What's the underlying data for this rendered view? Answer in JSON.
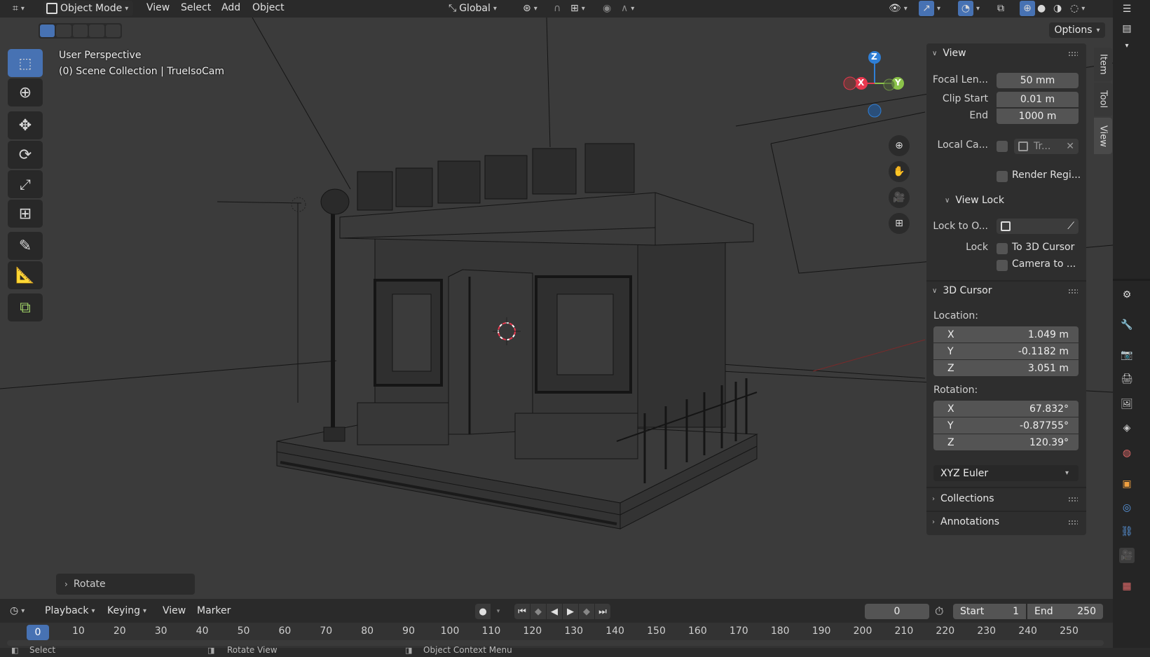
{
  "header": {
    "mode": "Object Mode",
    "menus": [
      "View",
      "Select",
      "Add",
      "Object"
    ],
    "orientation": "Global",
    "options_label": "Options"
  },
  "viewport": {
    "overlay_line1": "User Perspective",
    "overlay_line2": "(0) Scene Collection | TrueIsoCam",
    "gizmo_x": "X",
    "gizmo_y": "Y",
    "gizmo_z": "Z",
    "last_operator": "Rotate"
  },
  "tools": [
    "select-box",
    "cursor",
    "move",
    "rotate",
    "scale",
    "transform",
    "annotate",
    "measure",
    "add-cube"
  ],
  "npanel": {
    "tabs": [
      "Item",
      "Tool",
      "View"
    ],
    "view_section": {
      "title": "View",
      "focal_label": "Focal Len...",
      "focal_value": "50 mm",
      "clip_start_label": "Clip Start",
      "clip_start_value": "0.01 m",
      "end_label": "End",
      "end_value": "1000 m",
      "local_cam_label": "Local Ca...",
      "local_cam_value": "Tr...",
      "render_region_label": "Render Regi..."
    },
    "view_lock": {
      "title": "View Lock",
      "lock_to_label": "Lock to O...",
      "lock_label": "Lock",
      "to_3d_cursor": "To 3D Cursor",
      "camera_to": "Camera to ..."
    },
    "cursor_section": {
      "title": "3D Cursor",
      "location_label": "Location:",
      "loc_x_label": "X",
      "loc_x": "1.049 m",
      "loc_y_label": "Y",
      "loc_y": "-0.1182 m",
      "loc_z_label": "Z",
      "loc_z": "3.051 m",
      "rotation_label": "Rotation:",
      "rot_x_label": "X",
      "rot_x": "67.832°",
      "rot_y_label": "Y",
      "rot_y": "-0.87755°",
      "rot_z_label": "Z",
      "rot_z": "120.39°",
      "rot_mode": "XYZ Euler"
    },
    "collections_title": "Collections",
    "annotations_title": "Annotations"
  },
  "timeline": {
    "menus": [
      "Playback",
      "Keying",
      "View",
      "Marker"
    ],
    "current_frame": "0",
    "start_label": "Start",
    "start_value": "1",
    "end_label": "End",
    "end_value": "250",
    "ticks": [
      "0",
      "10",
      "20",
      "30",
      "40",
      "50",
      "60",
      "70",
      "80",
      "90",
      "100",
      "110",
      "120",
      "130",
      "140",
      "150",
      "160",
      "170",
      "180",
      "190",
      "200",
      "210",
      "220",
      "230",
      "240",
      "250"
    ],
    "playhead": "0"
  },
  "statusbar": {
    "select": "Select",
    "rotate_view": "Rotate View",
    "context_menu": "Object Context Menu"
  },
  "colors": {
    "accent": "#4772b3",
    "axis_x": "#e8384f",
    "axis_y": "#8bc34a",
    "axis_z": "#2f7fd6"
  }
}
